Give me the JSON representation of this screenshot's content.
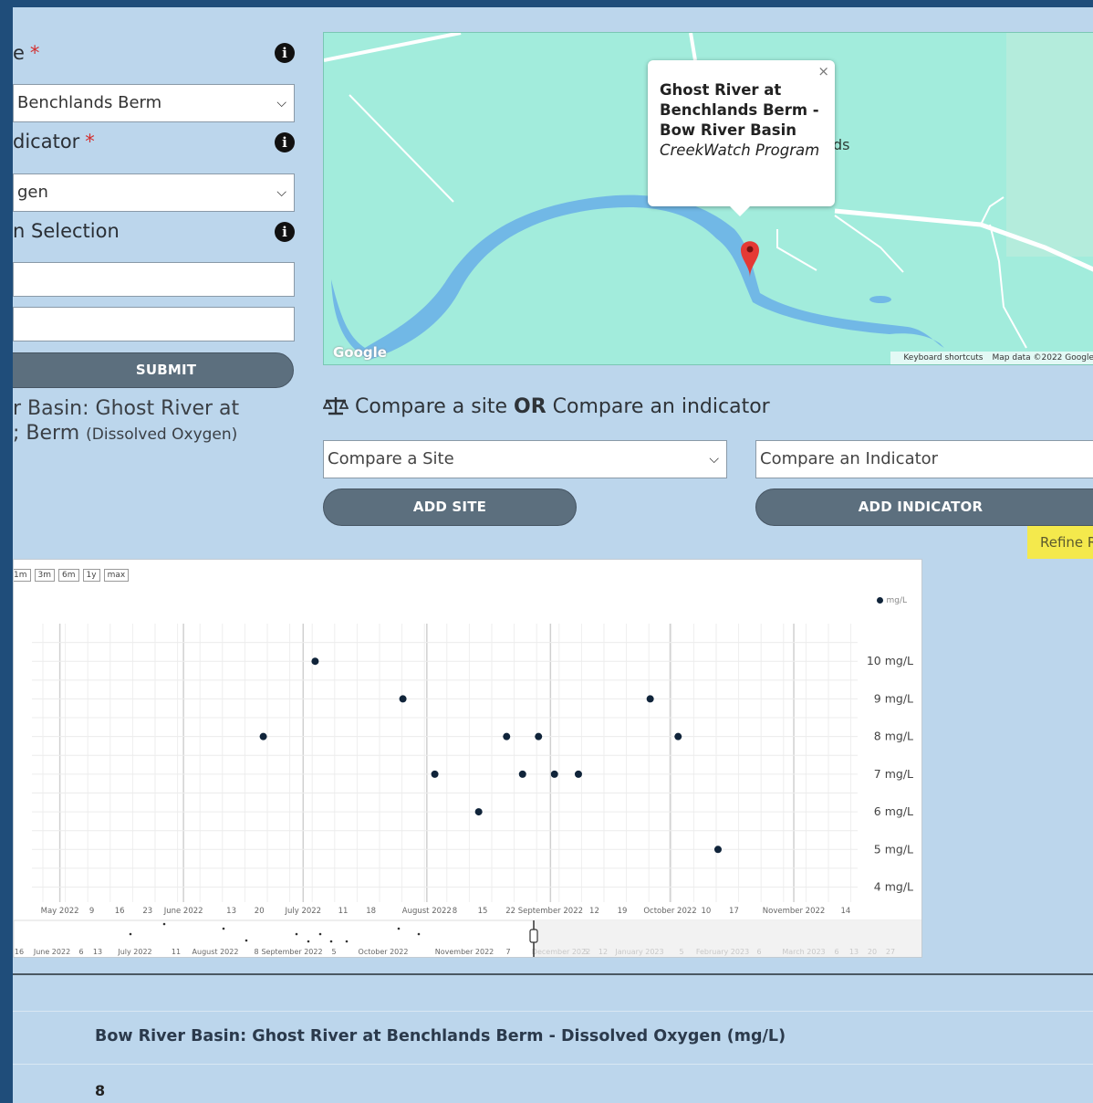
{
  "form": {
    "site_label": "e",
    "site_value": "Benchlands Berm",
    "indicator_label": "dicator",
    "indicator_value": "gen",
    "date_label": "n Selection",
    "required_mark": "*",
    "info_glyph": "i",
    "submit_label": "SUBMIT",
    "result_line1": "r Basin: Ghost River at",
    "result_line2": "; Berm",
    "result_param": "(Dissolved Oxygen)"
  },
  "map": {
    "popup_title": "Ghost River at Benchlands Berm - Bow River Basin",
    "popup_program": "CreekWatch Program",
    "popup_close": "×",
    "partial_label": "ds",
    "logo": "Google",
    "attribution_shortcuts": "Keyboard shortcuts",
    "attribution_data": "Map data ©2022 Google",
    "marker_color": "#e53935"
  },
  "compare": {
    "icon": "balance-scale-icon",
    "heading_a": "Compare a site",
    "heading_or": "OR",
    "heading_b": "Compare an indicator",
    "site_select": "Compare a Site",
    "indicator_select": "Compare an Indicator",
    "add_site": "ADD SITE",
    "add_indicator": "ADD INDICATOR",
    "refine": "Refine R"
  },
  "chart": {
    "range_buttons": [
      "1m",
      "3m",
      "6m",
      "1y",
      "max"
    ],
    "legend_label": "mg/L",
    "x_ticks": [
      "May 2022",
      "9",
      "16",
      "23",
      "June 2022",
      "13",
      "20",
      "July 2022",
      "11",
      "18",
      "August 2022",
      "8",
      "15",
      "22",
      "September 2022",
      "12",
      "19",
      "October 2022",
      "10",
      "17",
      "November 2022",
      "14"
    ],
    "navigator_ticks": [
      "16",
      "June 2022",
      "6",
      "13",
      "July 2022",
      "11",
      "August 2022",
      "8",
      "September 2022",
      "5",
      "October 2022",
      "November 2022",
      "7",
      "December 2022",
      "5",
      "12",
      "January 2023",
      "5",
      "February 2023",
      "6",
      "March 2023",
      "6",
      "13",
      "20",
      "27"
    ]
  },
  "chart_data": {
    "type": "scatter",
    "title": "",
    "xlabel": "",
    "ylabel": "",
    "y_unit": "mg/L",
    "y_ticks": [
      "4 mg/L",
      "5 mg/L",
      "6 mg/L",
      "7 mg/L",
      "8 mg/L",
      "9 mg/L",
      "10 mg/L"
    ],
    "ylim": [
      3.6,
      11
    ],
    "xlim": [
      "2022-04-24",
      "2022-11-17"
    ],
    "grid": true,
    "legend_position": "top-right",
    "series": [
      {
        "name": "mg/L",
        "color": "#10243a",
        "points": [
          {
            "x": "2022-06-21",
            "y": 8
          },
          {
            "x": "2022-07-04",
            "y": 10
          },
          {
            "x": "2022-07-26",
            "y": 9
          },
          {
            "x": "2022-08-03",
            "y": 7
          },
          {
            "x": "2022-08-14",
            "y": 6
          },
          {
            "x": "2022-08-21",
            "y": 8
          },
          {
            "x": "2022-08-25",
            "y": 7
          },
          {
            "x": "2022-08-29",
            "y": 8
          },
          {
            "x": "2022-09-02",
            "y": 7
          },
          {
            "x": "2022-09-08",
            "y": 7
          },
          {
            "x": "2022-09-26",
            "y": 9
          },
          {
            "x": "2022-10-03",
            "y": 8
          },
          {
            "x": "2022-10-13",
            "y": 5
          }
        ]
      }
    ]
  },
  "table": {
    "title": "Bow River Basin: Ghost River at Benchlands Berm - Dissolved Oxygen (mg/L)",
    "first_value": "8"
  }
}
